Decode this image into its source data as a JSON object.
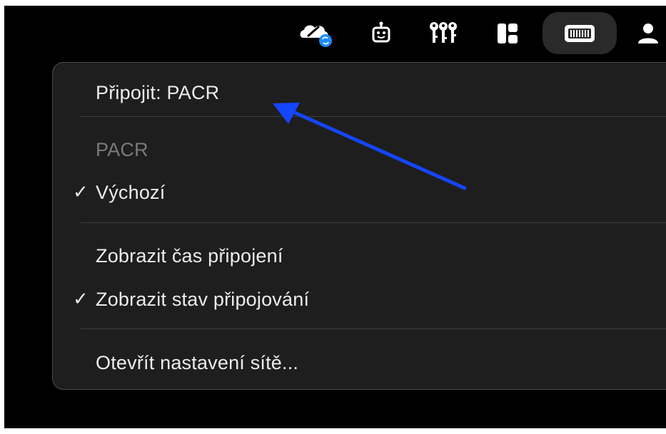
{
  "menubar": {
    "icons": [
      "cloud-sync-icon",
      "robot-icon",
      "keys-icon",
      "layout-icon",
      "vpn-icon",
      "user-icon"
    ],
    "highlight_color": "#2a2a2a"
  },
  "menu": {
    "connect_label": "Připojit: PACR",
    "section_header": "PACR",
    "default_item": "Výchozí",
    "show_connect_time": "Zobrazit čas připojení",
    "show_connect_status": "Zobrazit stav připojování",
    "open_network_settings": "Otevřít nastavení sítě...",
    "check_glyph": "✓"
  },
  "annotation": {
    "arrow_color": "#1446ff"
  }
}
